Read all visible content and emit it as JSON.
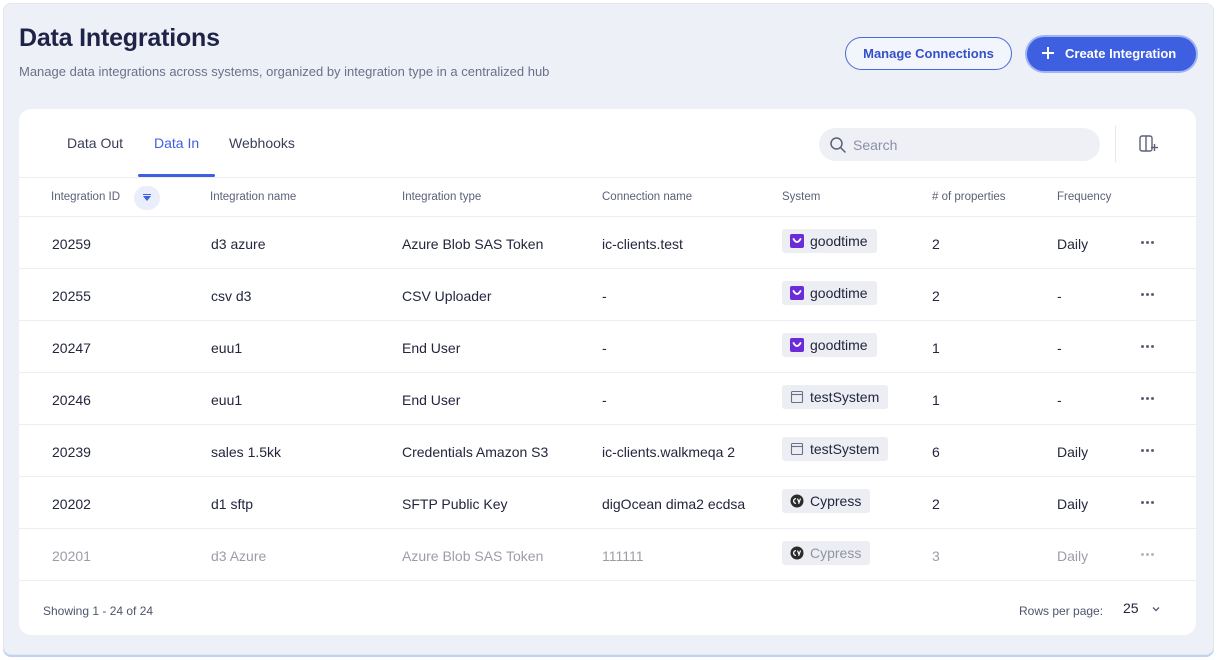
{
  "header": {
    "title": "Data Integrations",
    "subtitle": "Manage data integrations across systems, organized by integration type in a centralized hub",
    "manage_label": "Manage Connections",
    "create_label": "Create Integration"
  },
  "tabs": [
    {
      "label": "Data Out",
      "active": false
    },
    {
      "label": "Data In",
      "active": true
    },
    {
      "label": "Webhooks",
      "active": false
    }
  ],
  "search": {
    "placeholder": "Search",
    "value": ""
  },
  "columns": [
    "Integration ID",
    "Integration name",
    "Integration type",
    "Connection name",
    "System",
    "# of properties",
    "Frequency"
  ],
  "rows": [
    {
      "id": "20259",
      "name": "d3 azure",
      "type": "Azure Blob SAS Token",
      "connection": "ic-clients.test",
      "system": "goodtime",
      "system_icon": "goodtime-logo-icon",
      "properties": "2",
      "frequency": "Daily"
    },
    {
      "id": "20255",
      "name": "csv d3",
      "type": "CSV Uploader",
      "connection": "-",
      "system": "goodtime",
      "system_icon": "goodtime-logo-icon",
      "properties": "2",
      "frequency": "-"
    },
    {
      "id": "20247",
      "name": "euu1",
      "type": "End User",
      "connection": "-",
      "system": "goodtime",
      "system_icon": "goodtime-logo-icon",
      "properties": "1",
      "frequency": "-"
    },
    {
      "id": "20246",
      "name": "euu1",
      "type": "End User",
      "connection": "-",
      "system": "testSystem",
      "system_icon": "generic-system-icon",
      "properties": "1",
      "frequency": "-"
    },
    {
      "id": "20239",
      "name": "sales 1.5kk",
      "type": "Credentials Amazon S3",
      "connection": "ic-clients.walkmeqa 2",
      "system": "testSystem",
      "system_icon": "generic-system-icon",
      "properties": "6",
      "frequency": "Daily"
    },
    {
      "id": "20202",
      "name": "d1 sftp",
      "type": "SFTP Public Key",
      "connection": "digOcean dima2 ecdsa",
      "system": "Cypress",
      "system_icon": "cypress-logo-icon",
      "properties": "2",
      "frequency": "Daily"
    },
    {
      "id": "20201",
      "name": "d3 Azure",
      "type": "Azure Blob SAS Token",
      "connection": "111111",
      "system": "Cypress",
      "system_icon": "cypress-logo-icon",
      "properties": "3",
      "frequency": "Daily"
    }
  ],
  "footer": {
    "showing": "Showing 1 - 24 of 24",
    "rows_per_page_label": "Rows per page:",
    "rows_per_page_value": "25"
  },
  "colors": {
    "accent": "#3d5fe0",
    "goodtime": "#6a2bd9",
    "cypress": "#2b2b2b"
  }
}
